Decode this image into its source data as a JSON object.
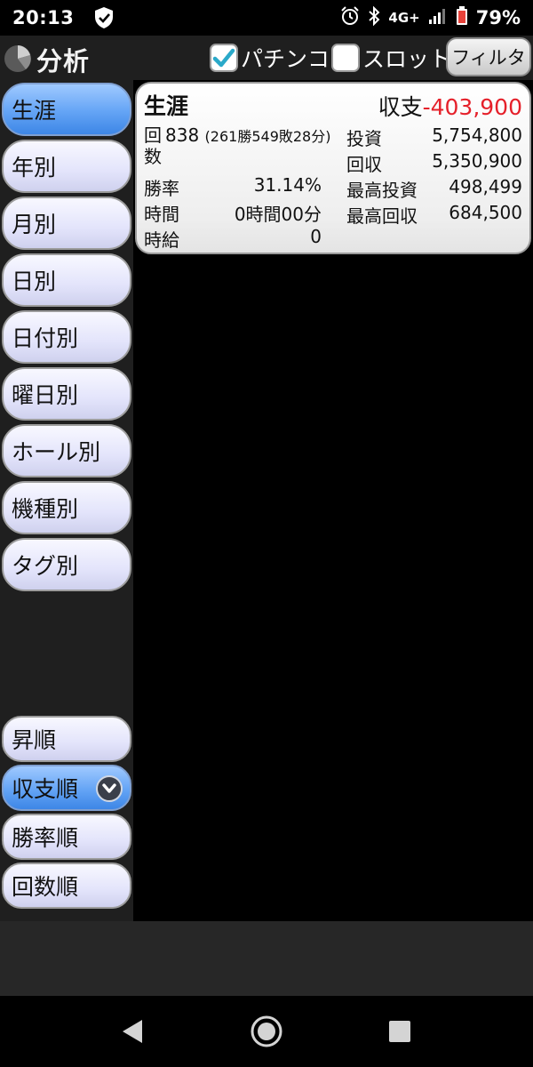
{
  "status_bar": {
    "time": "20:13",
    "network": "4G+",
    "battery": "79%"
  },
  "header": {
    "title": "分析",
    "pachinko_label": "パチンコ",
    "pachinko_checked": true,
    "slot_label": "スロット",
    "slot_checked": false,
    "filter_label": "フィルタ"
  },
  "sidebar": {
    "items": [
      {
        "label": "生涯",
        "active": true
      },
      {
        "label": "年別"
      },
      {
        "label": "月別"
      },
      {
        "label": "日別"
      },
      {
        "label": "日付別"
      },
      {
        "label": "曜日別"
      },
      {
        "label": "ホール別"
      },
      {
        "label": "機種別"
      },
      {
        "label": "タグ別"
      }
    ],
    "sort_items": [
      {
        "label": "昇順"
      },
      {
        "label": "収支順",
        "active": true
      },
      {
        "label": "勝率順"
      },
      {
        "label": "回数順"
      }
    ]
  },
  "summary": {
    "title": "生涯",
    "balance_label": "収支",
    "balance_value": "-403,900",
    "count_label": "回数",
    "count_value": "838",
    "count_detail": "(261勝549敗28分)",
    "winrate_label": "勝率",
    "winrate_value": "31.14%",
    "time_label": "時間",
    "time_value": "0時間00分",
    "hourly_label": "時給",
    "hourly_value": "0",
    "invest_label": "投資",
    "invest_value": "5,754,800",
    "recover_label": "回収",
    "recover_value": "5,350,900",
    "max_invest_label": "最高投資",
    "max_invest_value": "498,499",
    "max_recover_label": "最高回収",
    "max_recover_value": "684,500"
  },
  "colors": {
    "accent_blue": "#4a90f0",
    "negative": "#e5202a"
  }
}
